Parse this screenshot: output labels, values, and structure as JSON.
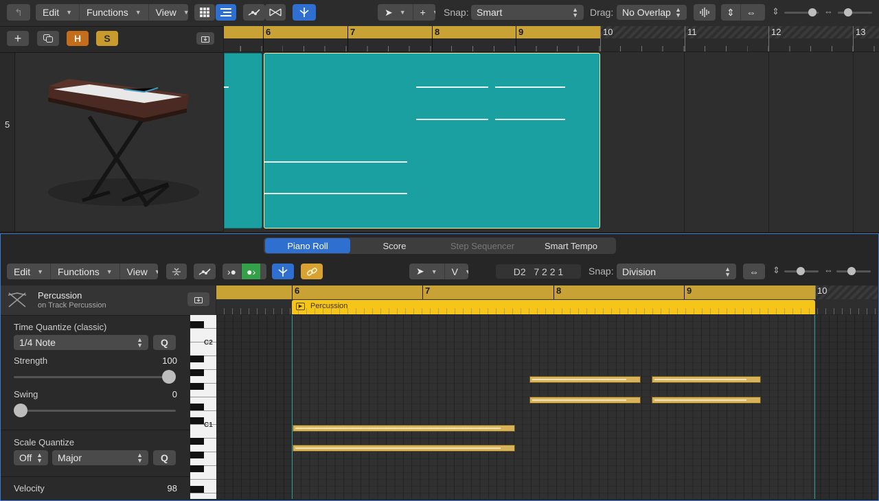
{
  "toolbar": {
    "menus": [
      "Edit",
      "Functions",
      "View"
    ],
    "snap_label": "Snap:",
    "snap_value": "Smart",
    "drag_label": "Drag:",
    "drag_value": "No Overlap"
  },
  "tracks_header": {
    "hide_button": "H",
    "solo_button": "S"
  },
  "track": {
    "number": "5",
    "instrument_icon": "keyboard-synth-image"
  },
  "arrange_ruler": [
    "6",
    "7",
    "8",
    "9",
    "10",
    "11",
    "12",
    "13"
  ],
  "editor_tabs": [
    "Piano Roll",
    "Score",
    "Step Sequencer",
    "Smart Tempo"
  ],
  "editor_toolbar": {
    "menus": [
      "Edit",
      "Functions",
      "View"
    ],
    "velocity_tool": "V",
    "position_display": "D2   7 2 2 1",
    "snap_label": "Snap:",
    "snap_value": "Division"
  },
  "inspector": {
    "region_name": "Percussion",
    "region_sub": "on Track Percussion",
    "time_quantize_title": "Time Quantize (classic)",
    "time_quantize_value": "1/4 Note",
    "q_button": "Q",
    "strength_label": "Strength",
    "strength_value": "100",
    "swing_label": "Swing",
    "swing_value": "0",
    "scale_quantize_title": "Scale Quantize",
    "scale_off": "Off",
    "scale_type": "Major",
    "velocity_label": "Velocity",
    "velocity_value": "98"
  },
  "piano_roll_ruler": [
    "6",
    "7",
    "8",
    "9",
    "10"
  ],
  "region": {
    "label": "Percussion"
  },
  "key_labels": {
    "c2": "C2",
    "c1": "C1"
  },
  "colors": {
    "region_teal": "#1aa0a0",
    "ruler_gold": "#c9a235",
    "region_yellow": "#f5c518",
    "note_gold": "#d7b45a",
    "accent_blue": "#2f6fd0"
  }
}
